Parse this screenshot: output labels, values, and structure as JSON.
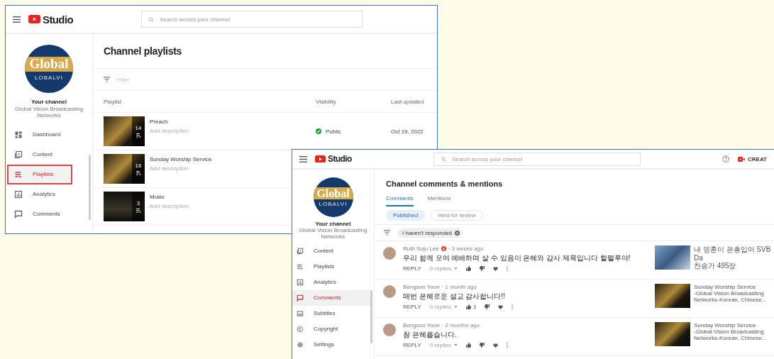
{
  "playlists_window": {
    "app_name": "Studio",
    "search": {
      "placeholder": "Search across your channel"
    },
    "channel": {
      "logo_text": "Global",
      "logo_subtext": "LOBALVI",
      "label": "Your channel",
      "name": "Global Vision Broadcasting Networks"
    },
    "nav": [
      {
        "kind": "dashboard",
        "label": "Dashboard",
        "selected": false
      },
      {
        "kind": "content",
        "label": "Content",
        "selected": false
      },
      {
        "kind": "playlists",
        "label": "Playlists",
        "selected": true
      },
      {
        "kind": "analytics",
        "label": "Analytics",
        "selected": false
      },
      {
        "kind": "comments",
        "label": "Comments",
        "selected": false
      }
    ],
    "page_title": "Channel playlists",
    "filter": {
      "placeholder": "Filter"
    },
    "table": {
      "columns": [
        "Playlist",
        "Visibility",
        "Last updated"
      ],
      "rows": [
        {
          "title": "Preach",
          "description": "Add description",
          "video_count": "14",
          "visibility": "Public",
          "last_updated": "Oct 19, 2022"
        },
        {
          "title": "Sunday Worship Service",
          "description": "Add description",
          "video_count": "16"
        },
        {
          "title": "Music",
          "description": "Add description",
          "video_count": "3"
        }
      ]
    }
  },
  "comments_window": {
    "app_name": "Studio",
    "search": {
      "placeholder": "Search across your channel"
    },
    "create_button": "CREAT",
    "channel": {
      "logo_text": "Global",
      "logo_subtext": "LOBALVI",
      "label": "Your channel",
      "name": "Global Vision Broadcasting Networks"
    },
    "nav": [
      {
        "kind": "content",
        "label": "Content",
        "selected": false
      },
      {
        "kind": "playlists",
        "label": "Playlists",
        "selected": false
      },
      {
        "kind": "analytics",
        "label": "Analytics",
        "selected": false
      },
      {
        "kind": "comments",
        "label": "Comments",
        "selected": true
      },
      {
        "kind": "subtitles",
        "label": "Subtitles",
        "selected": false
      },
      {
        "kind": "copyright",
        "label": "Copyright",
        "selected": false
      },
      {
        "kind": "settings",
        "label": "Settings",
        "selected": false
      }
    ],
    "page_title": "Channel comments & mentions",
    "tabs": [
      {
        "label": "Comments",
        "selected": true
      },
      {
        "label": "Mentions",
        "selected": false
      }
    ],
    "chips": [
      {
        "label": "Published",
        "selected": true
      },
      {
        "label": "Held for review",
        "selected": false
      }
    ],
    "filter_chip": "I haven't responded",
    "comments": [
      {
        "author": "Ruth Suju Lee",
        "badge": true,
        "time": "· 3 weeks ago",
        "text": "우리 함께 모여 예배하며 살 수 있음이 은혜와 감사 제목입니다 할렐루야!",
        "reply": "REPLY",
        "replies": "0 replies",
        "video": {
          "title_lines": [
            "내 영혼이 은총입어 SVB Da",
            "찬송가 495장"
          ]
        }
      },
      {
        "author": "Bongsoo Yoon",
        "badge": false,
        "time": "· 1 month ago",
        "text": "매번 은혜로운 설교 감사합니다!!",
        "reply": "REPLY",
        "replies": "0 replies",
        "likes": "1",
        "video": {
          "title_lines": [
            "Sunday Worship Service",
            "-Global Vision Broadcasting",
            "Networks-Korean, Chinese..."
          ]
        }
      },
      {
        "author": "Bongsoo Yoon",
        "badge": false,
        "time": "· 2 months ago",
        "text": "참 은혜롭습니다.",
        "reply": "REPLY",
        "replies": "0 replies",
        "video": {
          "title_lines": [
            "Sunday Worship Service",
            "-Global Vision Broadcasting",
            "Networks-Korean, Chinese..."
          ]
        }
      }
    ]
  }
}
